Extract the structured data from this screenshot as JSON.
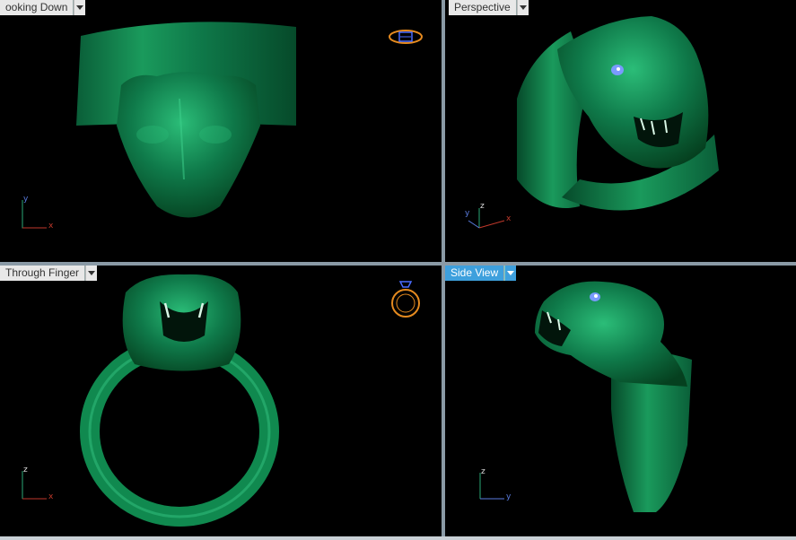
{
  "viewports": {
    "top_left": {
      "label": "ooking Down",
      "active": false,
      "axis_v": "y",
      "axis_h": "x"
    },
    "top_right": {
      "label": "Perspective",
      "active": false,
      "axis_v": "z",
      "axis_h": "x",
      "axis_extra": "y"
    },
    "bottom_left": {
      "label": "Through Finger",
      "active": false,
      "axis_v": "z",
      "axis_h": "x"
    },
    "bottom_right": {
      "label": "Side View",
      "active": true,
      "axis_v": "z",
      "axis_h": "y"
    }
  },
  "icons": {
    "top_left_gizmo": "ring-top-view-icon",
    "bottom_left_gizmo": "ring-front-view-icon"
  },
  "colors": {
    "model_green": "#0f7a4a",
    "highlight_green": "#3fd38e",
    "active_tab": "#3ea0dd",
    "gizmo_orange": "#e58a1f",
    "gizmo_blue": "#4a6cff",
    "axis_red": "#c0392b",
    "axis_green": "#2aa876",
    "axis_blue": "#5a7de0"
  }
}
